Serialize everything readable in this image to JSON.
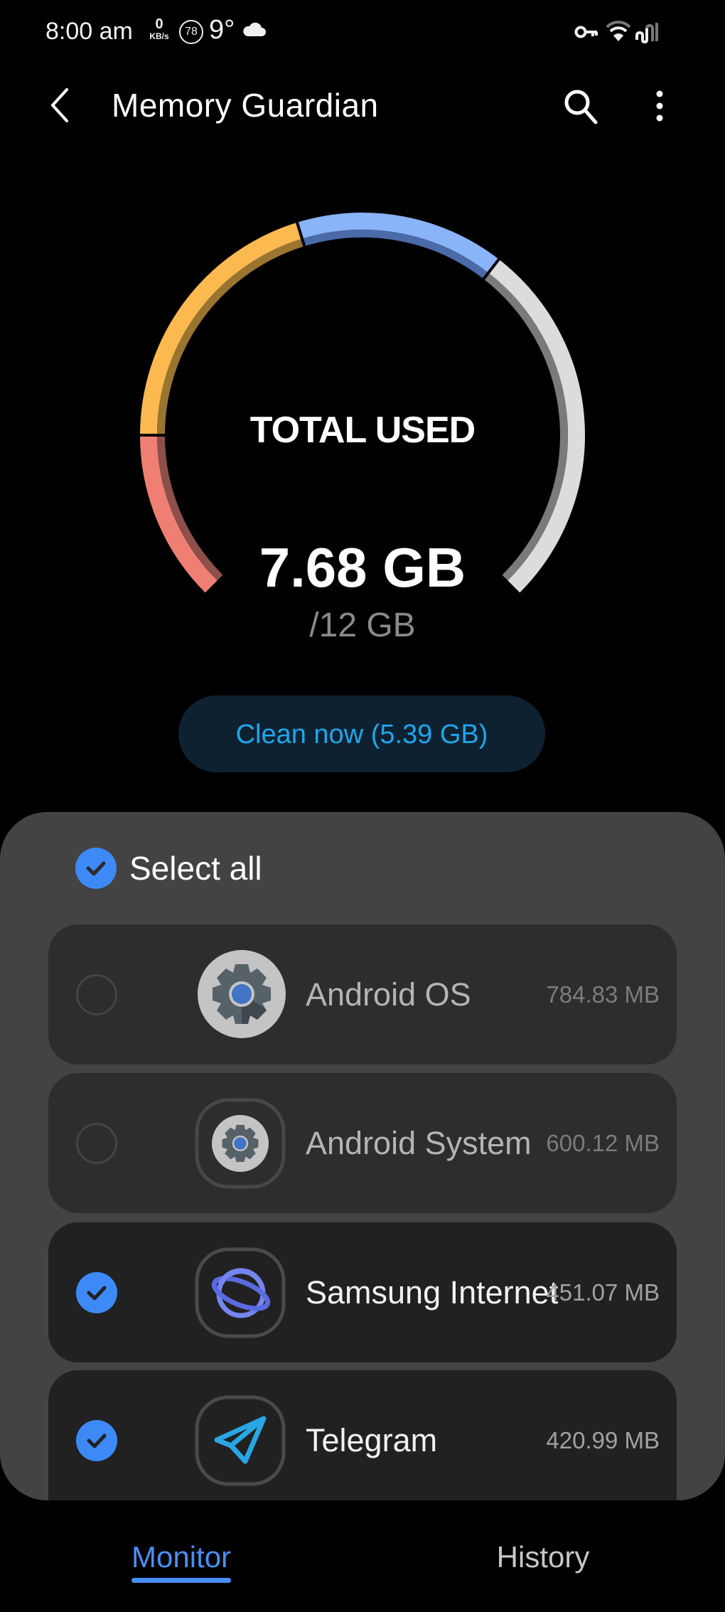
{
  "status_bar": {
    "time": "8:00 am",
    "net_speed_value": "0",
    "net_speed_unit": "KB/s",
    "badge": "78",
    "temperature": "9°",
    "weather_icon": "cloud-icon",
    "right_icons": [
      "vpn-key-icon",
      "wifi-icon",
      "signal-icon"
    ]
  },
  "header": {
    "title": "Memory Guardian",
    "back_icon": "chevron-left-icon",
    "search_icon": "search-icon",
    "more_icon": "more-vertical-icon"
  },
  "gauge": {
    "label": "TOTAL USED",
    "used": "7.68 GB",
    "total": "/12 GB",
    "used_gb": 7.68,
    "total_gb": 12,
    "segments": [
      {
        "name": "red",
        "value_gb": 2.0,
        "color": "#f07f73",
        "shade": "#8c4f49"
      },
      {
        "name": "yellow",
        "value_gb": 3.24,
        "color": "#fbb950",
        "shade": "#9a7530"
      },
      {
        "name": "blue",
        "value_gb": 2.44,
        "color": "#8ab4f8",
        "shade": "#4a6aa8"
      },
      {
        "name": "free",
        "value_gb": 4.32,
        "color": "#dcdcdc",
        "shade": "#7a7a7a"
      }
    ]
  },
  "clean_button": {
    "label": "Clean now (5.39 GB)"
  },
  "list": {
    "select_all": {
      "label": "Select all",
      "checked": true
    },
    "items": [
      {
        "name": "Android OS",
        "size": "784.83 MB",
        "checked": false,
        "icon": "android-os-gear-icon"
      },
      {
        "name": "Android System",
        "size": "600.12 MB",
        "checked": false,
        "icon": "android-system-gear-icon"
      },
      {
        "name": "Samsung Internet",
        "size": "451.07 MB",
        "checked": true,
        "icon": "samsung-internet-icon"
      },
      {
        "name": "Telegram",
        "size": "420.99 MB",
        "checked": true,
        "icon": "telegram-icon"
      }
    ]
  },
  "bottom_nav": {
    "tabs": [
      {
        "label": "Monitor",
        "active": true
      },
      {
        "label": "History",
        "active": false
      }
    ],
    "accent": "#4a8ff5"
  },
  "colors": {
    "check_blue": "#3d8af7",
    "clean_text": "#1ea6ea",
    "clean_bg": "#0e2131",
    "panel_bg": "#434343"
  }
}
